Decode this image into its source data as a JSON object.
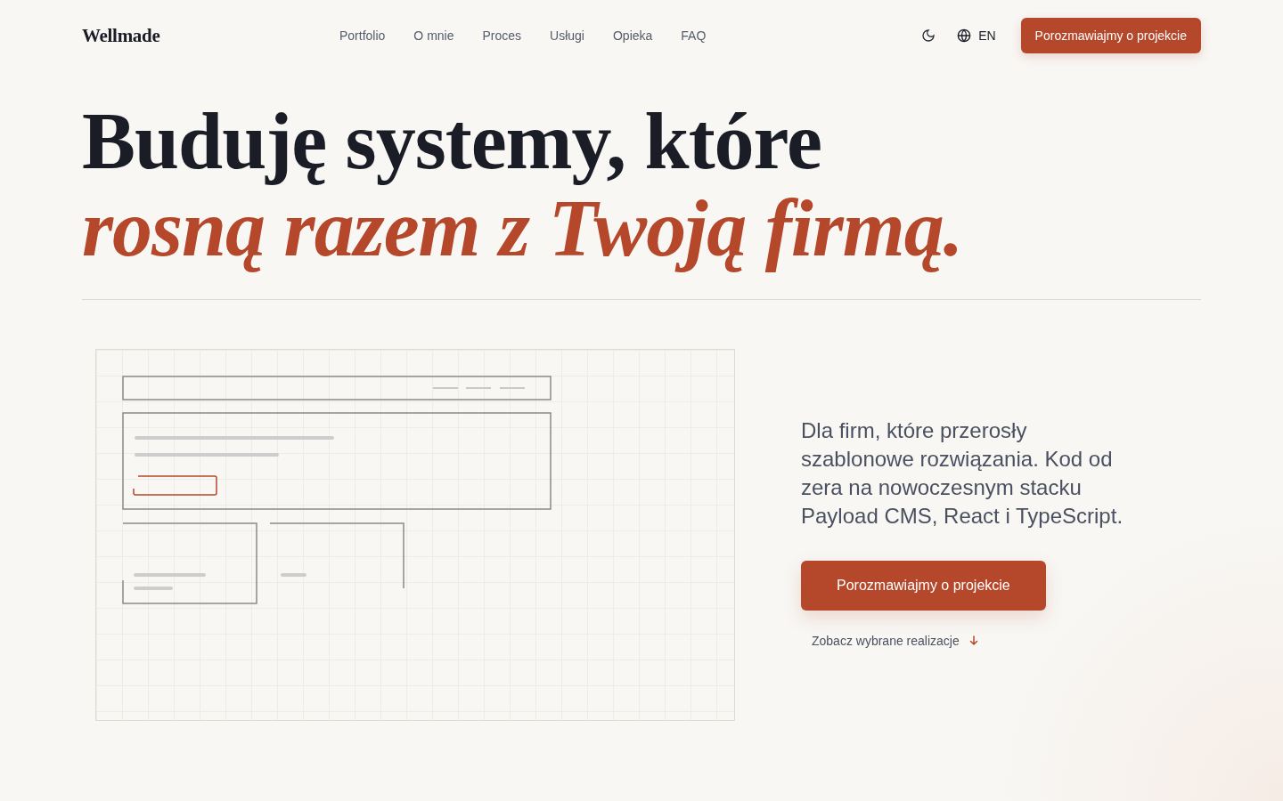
{
  "logo": "Wellmade",
  "nav": [
    {
      "label": "Portfolio"
    },
    {
      "label": "O mnie"
    },
    {
      "label": "Proces"
    },
    {
      "label": "Usługi"
    },
    {
      "label": "Opieka"
    },
    {
      "label": "FAQ"
    }
  ],
  "language": "EN",
  "header_button": "Porozmawiajmy o projekcie",
  "headline": {
    "line_1": "Buduję systemy, które",
    "line_2": "rosną razem z Twoją firmą."
  },
  "description": "Dla firm, które przerosły szablonowe rozwiązania. Kod od zera na nowoczesnym stacku Payload CMS, React i TypeScript.",
  "primary_button": "Porozmawiajmy o projekcie",
  "secondary_link": "Zobacz wybrane realizacje"
}
